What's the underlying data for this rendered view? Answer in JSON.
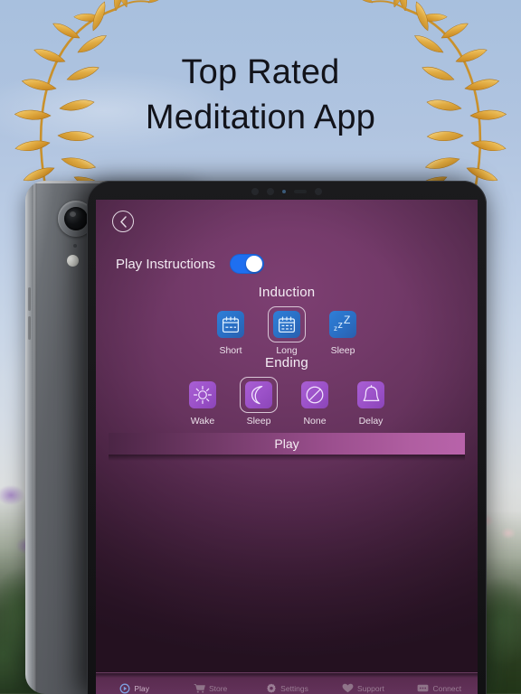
{
  "promo": {
    "headline_line1": "Top Rated",
    "headline_line2": "Meditation App",
    "wreath_color": "#e0a83c"
  },
  "app": {
    "back_button": "back-chevron",
    "play_instructions": {
      "label": "Play Instructions",
      "toggle_state": "on",
      "toggle_color": "#1e6ff0"
    },
    "induction": {
      "title": "Induction",
      "options": [
        {
          "label": "Short",
          "icon": "calendar-short-icon",
          "selected": false,
          "tile_color": "#2a6fc4"
        },
        {
          "label": "Long",
          "icon": "calendar-long-icon",
          "selected": true,
          "tile_color": "#2a6fc4"
        },
        {
          "label": "Sleep",
          "icon": "zzz-icon",
          "selected": false,
          "tile_color": "#2a6fc4"
        }
      ]
    },
    "ending": {
      "title": "Ending",
      "options": [
        {
          "label": "Wake",
          "icon": "sun-icon",
          "selected": false,
          "tile_color": "#9b51c8"
        },
        {
          "label": "Sleep",
          "icon": "moon-icon",
          "selected": true,
          "tile_color": "#9b51c8"
        },
        {
          "label": "None",
          "icon": "no-entry-icon",
          "selected": false,
          "tile_color": "#9b51c8"
        },
        {
          "label": "Delay",
          "icon": "bell-icon",
          "selected": false,
          "tile_color": "#9b51c8"
        }
      ]
    },
    "play_button": {
      "label": "Play"
    },
    "tabbar": {
      "tabs": [
        {
          "label": "Play",
          "icon": "play-circle-icon",
          "active": true
        },
        {
          "label": "Store",
          "icon": "cart-icon",
          "active": false
        },
        {
          "label": "Settings",
          "icon": "gear-icon",
          "active": false
        },
        {
          "label": "Support",
          "icon": "heart-icon",
          "active": false
        },
        {
          "label": "Connect",
          "icon": "chat-icon",
          "active": false
        }
      ]
    }
  }
}
